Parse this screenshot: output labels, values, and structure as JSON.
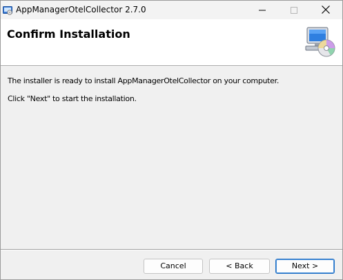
{
  "window": {
    "title": "AppManagerOtelCollector 2.7.0",
    "icon": "installer-app-icon",
    "controls": {
      "minimize_icon": "minimize-icon",
      "maximize_icon": "maximize-icon",
      "close_icon": "close-icon"
    }
  },
  "banner": {
    "title": "Confirm Installation",
    "graphic": "computer-disc-icon"
  },
  "body": {
    "line1": "The installer is ready to install AppManagerOtelCollector on your computer.",
    "line2": "Click \"Next\" to start the installation."
  },
  "buttons": {
    "cancel": "Cancel",
    "back": "< Back",
    "next": "Next >"
  },
  "colors": {
    "background": "#f0f0f0",
    "banner_background": "#ffffff",
    "default_button_border": "#1f6fc5"
  }
}
